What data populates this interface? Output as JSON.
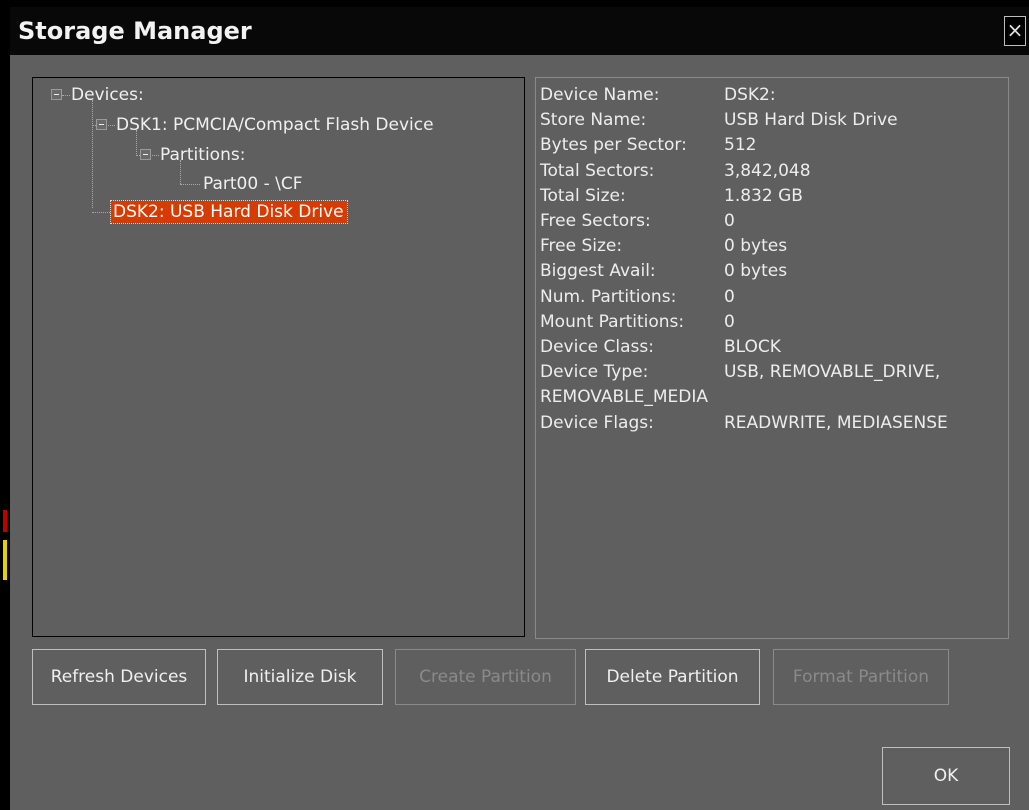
{
  "window": {
    "title": "Storage Manager",
    "close_symbol": "×"
  },
  "tree": {
    "root": "Devices:",
    "dsk1": "DSK1: PCMCIA/Compact Flash Device",
    "partitions": "Partitions:",
    "part00": "Part00 - \\CF",
    "dsk2": "DSK2: USB Hard Disk Drive"
  },
  "details": {
    "rows": [
      {
        "label": "Device Name:",
        "value": "DSK2:"
      },
      {
        "label": "Store Name:",
        "value": "USB Hard Disk Drive"
      },
      {
        "label": "Bytes per Sector:",
        "value": "512"
      },
      {
        "label": "Total Sectors:",
        "value": "3,842,048"
      },
      {
        "label": "Total Size:",
        "value": "1.832 GB"
      },
      {
        "label": "Free Sectors:",
        "value": "0"
      },
      {
        "label": "Free Size:",
        "value": "0 bytes"
      },
      {
        "label": "Biggest Avail:",
        "value": "0 bytes"
      },
      {
        "label": "Num. Partitions:",
        "value": "0"
      },
      {
        "label": "Mount Partitions:",
        "value": "0"
      },
      {
        "label": "Device Class:",
        "value": "BLOCK"
      },
      {
        "label": "Device Type:",
        "value": "USB, REMOVABLE_DRIVE,"
      },
      {
        "label": "REMOVABLE_MEDIA",
        "value": ""
      },
      {
        "label": "Device Flags:",
        "value": "READWRITE, MEDIASENSE"
      }
    ]
  },
  "buttons": {
    "refresh": "Refresh Devices",
    "initialize": "Initialize Disk",
    "create": "Create Partition",
    "delete": "Delete Partition",
    "format": "Format Partition",
    "ok": "OK"
  },
  "colors": {
    "selection": "#d83b01",
    "window_bg": "#5f5f5f",
    "titlebar_bg": "#080808"
  }
}
